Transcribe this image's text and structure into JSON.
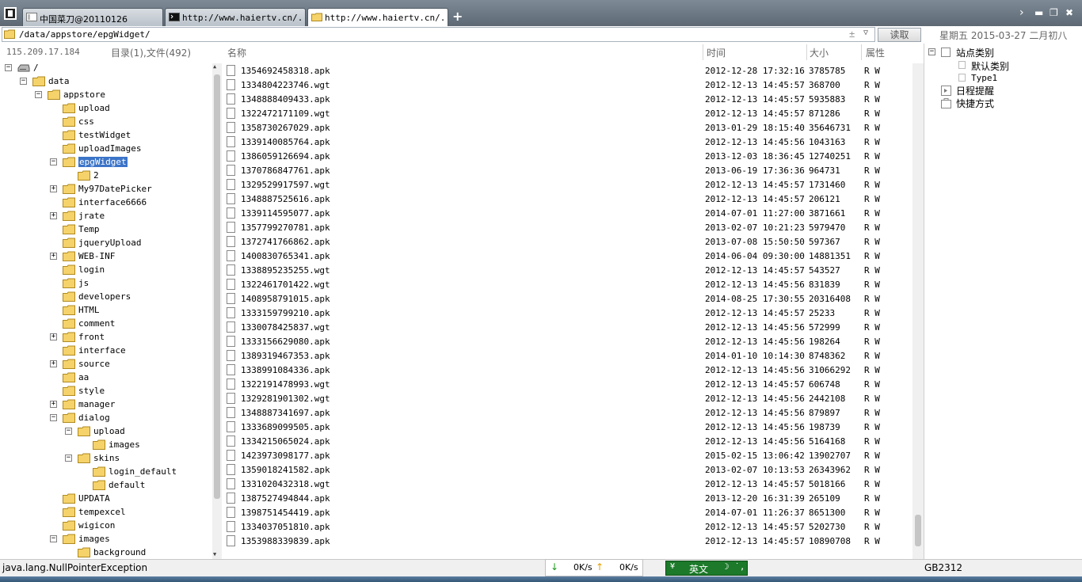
{
  "tabs": [
    {
      "label": "中国菜刀@20110126",
      "icon": "page-icon"
    },
    {
      "label": "http://www.haiertv.cn/...",
      "icon": "terminal-icon"
    },
    {
      "label": "http://www.haiertv.cn/...",
      "icon": "folder-icon"
    }
  ],
  "address": {
    "path": "/data/appstore/epgWidget/",
    "read_label": "读取"
  },
  "datebar": "星期五 2015-03-27 二月初八",
  "left_header": {
    "ip": "115.209.17.184",
    "summary": "目录(1),文件(492)"
  },
  "columns": {
    "name": "名称",
    "time": "时间",
    "size": "大小",
    "attr": "属性"
  },
  "tree": [
    {
      "label": "/",
      "depth": 0,
      "toggle": "-",
      "icon": "drive-icon"
    },
    {
      "label": "data",
      "depth": 1,
      "toggle": "-",
      "icon": "folder-icon"
    },
    {
      "label": "appstore",
      "depth": 2,
      "toggle": "-",
      "icon": "folder-icon"
    },
    {
      "label": "upload",
      "depth": 3,
      "toggle": "",
      "icon": "folder-icon"
    },
    {
      "label": "css",
      "depth": 3,
      "toggle": "",
      "icon": "folder-icon"
    },
    {
      "label": "testWidget",
      "depth": 3,
      "toggle": "",
      "icon": "folder-icon"
    },
    {
      "label": "uploadImages",
      "depth": 3,
      "toggle": "",
      "icon": "folder-icon"
    },
    {
      "label": "epgWidget",
      "depth": 3,
      "toggle": "-",
      "icon": "folder-icon",
      "selected": true
    },
    {
      "label": "2",
      "depth": 4,
      "toggle": "",
      "icon": "folder-icon"
    },
    {
      "label": "My97DatePicker",
      "depth": 3,
      "toggle": "+",
      "icon": "folder-icon"
    },
    {
      "label": "interface6666",
      "depth": 3,
      "toggle": "",
      "icon": "folder-icon"
    },
    {
      "label": "jrate",
      "depth": 3,
      "toggle": "+",
      "icon": "folder-icon"
    },
    {
      "label": "Temp",
      "depth": 3,
      "toggle": "",
      "icon": "folder-icon"
    },
    {
      "label": "jqueryUpload",
      "depth": 3,
      "toggle": "",
      "icon": "folder-icon"
    },
    {
      "label": "WEB-INF",
      "depth": 3,
      "toggle": "+",
      "icon": "folder-icon"
    },
    {
      "label": "login",
      "depth": 3,
      "toggle": "",
      "icon": "folder-icon"
    },
    {
      "label": "js",
      "depth": 3,
      "toggle": "",
      "icon": "folder-icon"
    },
    {
      "label": "developers",
      "depth": 3,
      "toggle": "",
      "icon": "folder-icon"
    },
    {
      "label": "HTML",
      "depth": 3,
      "toggle": "",
      "icon": "folder-icon"
    },
    {
      "label": "comment",
      "depth": 3,
      "toggle": "",
      "icon": "folder-icon"
    },
    {
      "label": "front",
      "depth": 3,
      "toggle": "+",
      "icon": "folder-icon"
    },
    {
      "label": "interface",
      "depth": 3,
      "toggle": "",
      "icon": "folder-icon"
    },
    {
      "label": "source",
      "depth": 3,
      "toggle": "+",
      "icon": "folder-icon"
    },
    {
      "label": "aa",
      "depth": 3,
      "toggle": "",
      "icon": "folder-icon"
    },
    {
      "label": "style",
      "depth": 3,
      "toggle": "",
      "icon": "folder-icon"
    },
    {
      "label": "manager",
      "depth": 3,
      "toggle": "+",
      "icon": "folder-icon"
    },
    {
      "label": "dialog",
      "depth": 3,
      "toggle": "-",
      "icon": "folder-icon"
    },
    {
      "label": "upload",
      "depth": 4,
      "toggle": "-",
      "icon": "folder-icon"
    },
    {
      "label": "images",
      "depth": 5,
      "toggle": "",
      "icon": "folder-icon"
    },
    {
      "label": "skins",
      "depth": 4,
      "toggle": "-",
      "icon": "folder-icon"
    },
    {
      "label": "login_default",
      "depth": 5,
      "toggle": "",
      "icon": "folder-icon"
    },
    {
      "label": "default",
      "depth": 5,
      "toggle": "",
      "icon": "folder-icon"
    },
    {
      "label": "UPDATA",
      "depth": 3,
      "toggle": "",
      "icon": "folder-icon"
    },
    {
      "label": "tempexcel",
      "depth": 3,
      "toggle": "",
      "icon": "folder-icon"
    },
    {
      "label": "wigicon",
      "depth": 3,
      "toggle": "",
      "icon": "folder-icon"
    },
    {
      "label": "images",
      "depth": 3,
      "toggle": "-",
      "icon": "folder-icon"
    },
    {
      "label": "background",
      "depth": 4,
      "toggle": "",
      "icon": "folder-icon"
    }
  ],
  "files": [
    {
      "name": "1354692458318.apk",
      "time": "2012-12-28 17:32:16",
      "size": "3785785",
      "attr": "R W"
    },
    {
      "name": "1334804223746.wgt",
      "time": "2012-12-13 14:45:57",
      "size": "368700",
      "attr": "R W"
    },
    {
      "name": "1348888409433.apk",
      "time": "2012-12-13 14:45:57",
      "size": "5935883",
      "attr": "R W"
    },
    {
      "name": "1322472171109.wgt",
      "time": "2012-12-13 14:45:57",
      "size": "871286",
      "attr": "R W"
    },
    {
      "name": "1358730267029.apk",
      "time": "2013-01-29 18:15:40",
      "size": "35646731",
      "attr": "R W"
    },
    {
      "name": "1339140085764.apk",
      "time": "2012-12-13 14:45:56",
      "size": "1043163",
      "attr": "R W"
    },
    {
      "name": "1386059126694.apk",
      "time": "2013-12-03 18:36:45",
      "size": "12740251",
      "attr": "R W"
    },
    {
      "name": "1370786847761.apk",
      "time": "2013-06-19 17:36:36",
      "size": "964731",
      "attr": "R W"
    },
    {
      "name": "1329529917597.wgt",
      "time": "2012-12-13 14:45:57",
      "size": "1731460",
      "attr": "R W"
    },
    {
      "name": "1348887525616.apk",
      "time": "2012-12-13 14:45:57",
      "size": "206121",
      "attr": "R W"
    },
    {
      "name": "1339114595077.apk",
      "time": "2014-07-01 11:27:00",
      "size": "3871661",
      "attr": "R W"
    },
    {
      "name": "1357799270781.apk",
      "time": "2013-02-07 10:21:23",
      "size": "5979470",
      "attr": "R W"
    },
    {
      "name": "1372741766862.apk",
      "time": "2013-07-08 15:50:50",
      "size": "597367",
      "attr": "R W"
    },
    {
      "name": "1400830765341.apk",
      "time": "2014-06-04 09:30:00",
      "size": "14881351",
      "attr": "R W"
    },
    {
      "name": "1338895235255.wgt",
      "time": "2012-12-13 14:45:57",
      "size": "543527",
      "attr": "R W"
    },
    {
      "name": "1322461701422.wgt",
      "time": "2012-12-13 14:45:56",
      "size": "831839",
      "attr": "R W"
    },
    {
      "name": "1408958791015.apk",
      "time": "2014-08-25 17:30:55",
      "size": "20316408",
      "attr": "R W"
    },
    {
      "name": "1333159799210.apk",
      "time": "2012-12-13 14:45:57",
      "size": "25233",
      "attr": "R W"
    },
    {
      "name": "1330078425837.wgt",
      "time": "2012-12-13 14:45:56",
      "size": "572999",
      "attr": "R W"
    },
    {
      "name": "1333156629080.apk",
      "time": "2012-12-13 14:45:56",
      "size": "198264",
      "attr": "R W"
    },
    {
      "name": "1389319467353.apk",
      "time": "2014-01-10 10:14:30",
      "size": "8748362",
      "attr": "R W"
    },
    {
      "name": "1338991084336.apk",
      "time": "2012-12-13 14:45:56",
      "size": "31066292",
      "attr": "R W"
    },
    {
      "name": "1322191478993.wgt",
      "time": "2012-12-13 14:45:57",
      "size": "606748",
      "attr": "R W"
    },
    {
      "name": "1329281901302.wgt",
      "time": "2012-12-13 14:45:56",
      "size": "2442108",
      "attr": "R W"
    },
    {
      "name": "1348887341697.apk",
      "time": "2012-12-13 14:45:56",
      "size": "879897",
      "attr": "R W"
    },
    {
      "name": "1333689099505.apk",
      "time": "2012-12-13 14:45:56",
      "size": "198739",
      "attr": "R W"
    },
    {
      "name": "1334215065024.apk",
      "time": "2012-12-13 14:45:56",
      "size": "5164168",
      "attr": "R W"
    },
    {
      "name": "1423973098177.apk",
      "time": "2015-02-15 13:06:42",
      "size": "13902707",
      "attr": "R W"
    },
    {
      "name": "1359018241582.apk",
      "time": "2013-02-07 10:13:53",
      "size": "26343962",
      "attr": "R W"
    },
    {
      "name": "1331020432318.wgt",
      "time": "2012-12-13 14:45:57",
      "size": "5018166",
      "attr": "R W"
    },
    {
      "name": "1387527494844.apk",
      "time": "2013-12-20 16:31:39",
      "size": "265109",
      "attr": "R W"
    },
    {
      "name": "1398751454419.apk",
      "time": "2014-07-01 11:26:37",
      "size": "8651300",
      "attr": "R W"
    },
    {
      "name": "1334037051810.apk",
      "time": "2012-12-13 14:45:57",
      "size": "5202730",
      "attr": "R W"
    },
    {
      "name": "1353988339839.apk",
      "time": "2012-12-13 14:45:57",
      "size": "10890708",
      "attr": "R W"
    }
  ],
  "right_panel": {
    "site_category": "站点类别",
    "sub_items": [
      "默认类别",
      "Type1"
    ],
    "schedule": "日程提醒",
    "shortcuts": "快捷方式"
  },
  "status": {
    "message": "java.lang.NullPointerException",
    "down_speed": "0K/s",
    "up_speed": "0K/s",
    "ime_label": "英文",
    "encoding": "GB2312"
  },
  "colors": {
    "folder": "#f5d36a",
    "selection": "#3b74c8",
    "ime_bg": "#1c7a2a"
  }
}
